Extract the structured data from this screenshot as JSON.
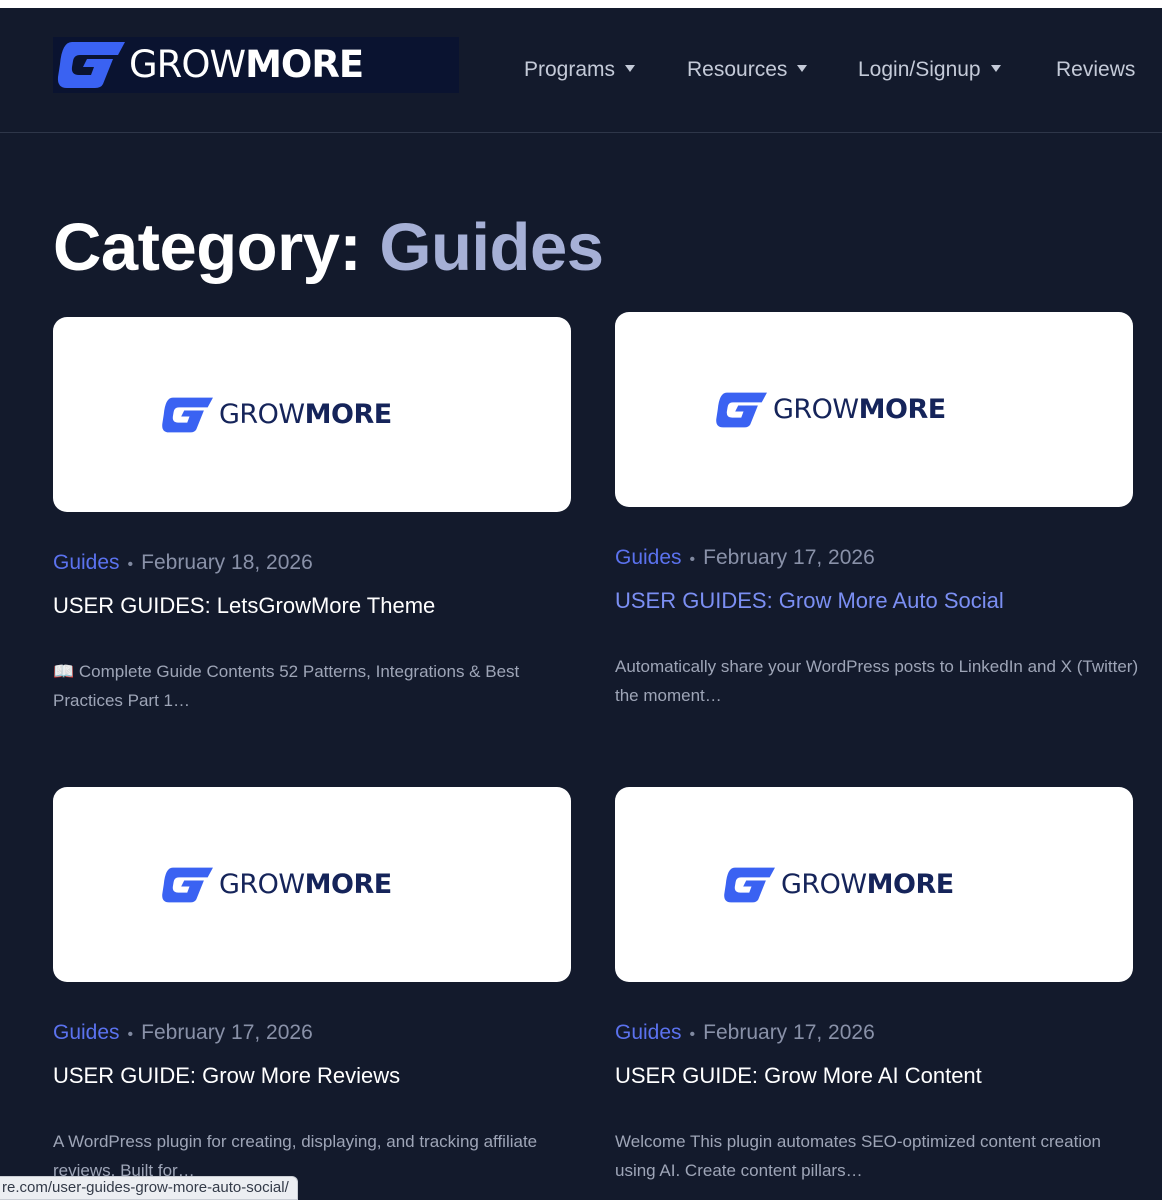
{
  "brand": {
    "grow": "GROW",
    "more": "MORE",
    "accent": "#4f6ff0"
  },
  "nav": [
    {
      "label": "Programs",
      "dropdown": true
    },
    {
      "label": "Resources",
      "dropdown": true
    },
    {
      "label": "Login/Signup",
      "dropdown": true
    },
    {
      "label": "Reviews",
      "dropdown": false
    }
  ],
  "title": {
    "prefix": "Category:",
    "term": "Guides"
  },
  "posts": [
    {
      "category": "Guides",
      "date": "February 18, 2026",
      "title": "USER GUIDES: LetsGrowMore Theme",
      "excerpt": "📖 Complete Guide Contents 52 Patterns, Integrations & Best Practices Part 1…",
      "image_brand": {
        "grow": "GROW",
        "more": "MORE"
      }
    },
    {
      "category": "Guides",
      "date": "February 17, 2026",
      "title": "USER GUIDES: Grow More Auto Social",
      "excerpt": "Automatically share your WordPress posts to LinkedIn and X (Twitter) the moment…",
      "image_brand": {
        "grow": "GROW",
        "more": "MORE"
      }
    },
    {
      "category": "Guides",
      "date": "February 17, 2026",
      "title": "USER GUIDE: Grow More Reviews",
      "excerpt": "A WordPress plugin for creating, displaying, and tracking affiliate reviews. Built for…",
      "image_brand": {
        "grow": "GROW",
        "more": "MORE"
      }
    },
    {
      "category": "Guides",
      "date": "February 17, 2026",
      "title": "USER GUIDE: Grow More AI Content",
      "excerpt": "Welcome This plugin automates SEO-optimized content creation using AI. Create content pillars…",
      "image_brand": {
        "grow": "GROW",
        "more": "MORE"
      }
    }
  ],
  "status_url": "re.com/user-guides-grow-more-auto-social/"
}
